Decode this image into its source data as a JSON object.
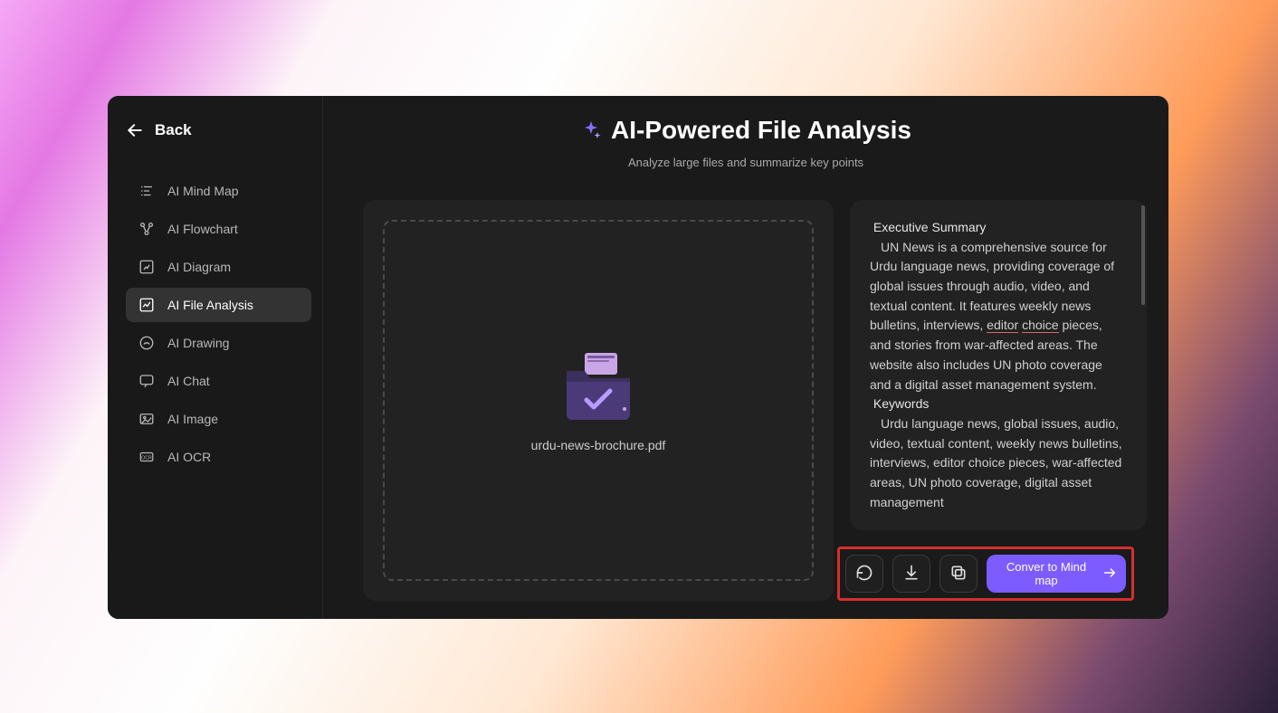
{
  "sidebar": {
    "back_label": "Back",
    "items": [
      {
        "label": "AI Mind Map"
      },
      {
        "label": "AI Flowchart"
      },
      {
        "label": "AI Diagram"
      },
      {
        "label": "AI File Analysis"
      },
      {
        "label": "AI Drawing"
      },
      {
        "label": "AI Chat"
      },
      {
        "label": "AI Image"
      },
      {
        "label": "AI OCR"
      }
    ],
    "active_index": 3
  },
  "header": {
    "title": "AI-Powered File Analysis",
    "subtitle": "Analyze large files and summarize key points"
  },
  "upload": {
    "file_name": "urdu-news-brochure.pdf"
  },
  "result": {
    "summary_heading": "Executive Summary",
    "summary_body_part1": "UN News is a comprehensive source for Urdu language news, providing coverage of global issues through audio, video, and textual content. It features weekly news bulletins, interviews, ",
    "summary_underlined_1": "editor",
    "summary_underlined_2": "choice",
    "summary_body_part2": " pieces, and stories from war-affected areas. The website also includes UN photo coverage and a digital asset management system.",
    "keywords_heading": "Keywords",
    "keywords_body": "Urdu language news, global issues, audio, video, textual content, weekly news bulletins, interviews, editor choice pieces, war-affected areas, UN photo coverage, digital asset management"
  },
  "actions": {
    "convert_label": "Conver to Mind map"
  },
  "colors": {
    "accent_purple": "#7c5cff",
    "highlight_red": "#d62e2e"
  }
}
